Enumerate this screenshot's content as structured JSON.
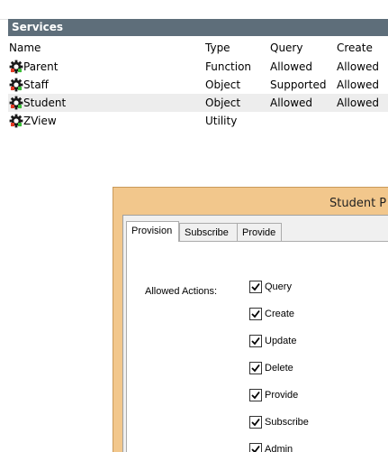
{
  "panel": {
    "title": "Services",
    "columns": {
      "name": "Name",
      "type": "Type",
      "query": "Query",
      "create": "Create"
    },
    "rows": [
      {
        "name": "Parent",
        "type": "Function",
        "query": "Allowed",
        "create": "Allowed"
      },
      {
        "name": "Staff",
        "type": "Object",
        "query": "Supported",
        "create": "Allowed"
      },
      {
        "name": "Student",
        "type": "Object",
        "query": "Allowed",
        "create": "Allowed"
      },
      {
        "name": "ZView",
        "type": "Utility",
        "query": "",
        "create": ""
      }
    ],
    "selected_row": "Student"
  },
  "dialog": {
    "title": "Student P",
    "tabs": [
      "Provision",
      "Subscribe",
      "Provide"
    ],
    "active_tab": "Provision",
    "allowed_actions_label": "Allowed Actions:",
    "actions": [
      {
        "label": "Query",
        "checked": true
      },
      {
        "label": "Create",
        "checked": true
      },
      {
        "label": "Update",
        "checked": true
      },
      {
        "label": "Delete",
        "checked": true
      },
      {
        "label": "Provide",
        "checked": true
      },
      {
        "label": "Subscribe",
        "checked": true
      },
      {
        "label": "Admin",
        "checked": true
      }
    ]
  },
  "colors": {
    "header_bg": "#5e6e7a",
    "dialog_frame": "#f2c78c",
    "selected_row": "#ededed"
  },
  "icons": {
    "row_icon": "gear-icon",
    "check_mark": "check-icon"
  }
}
